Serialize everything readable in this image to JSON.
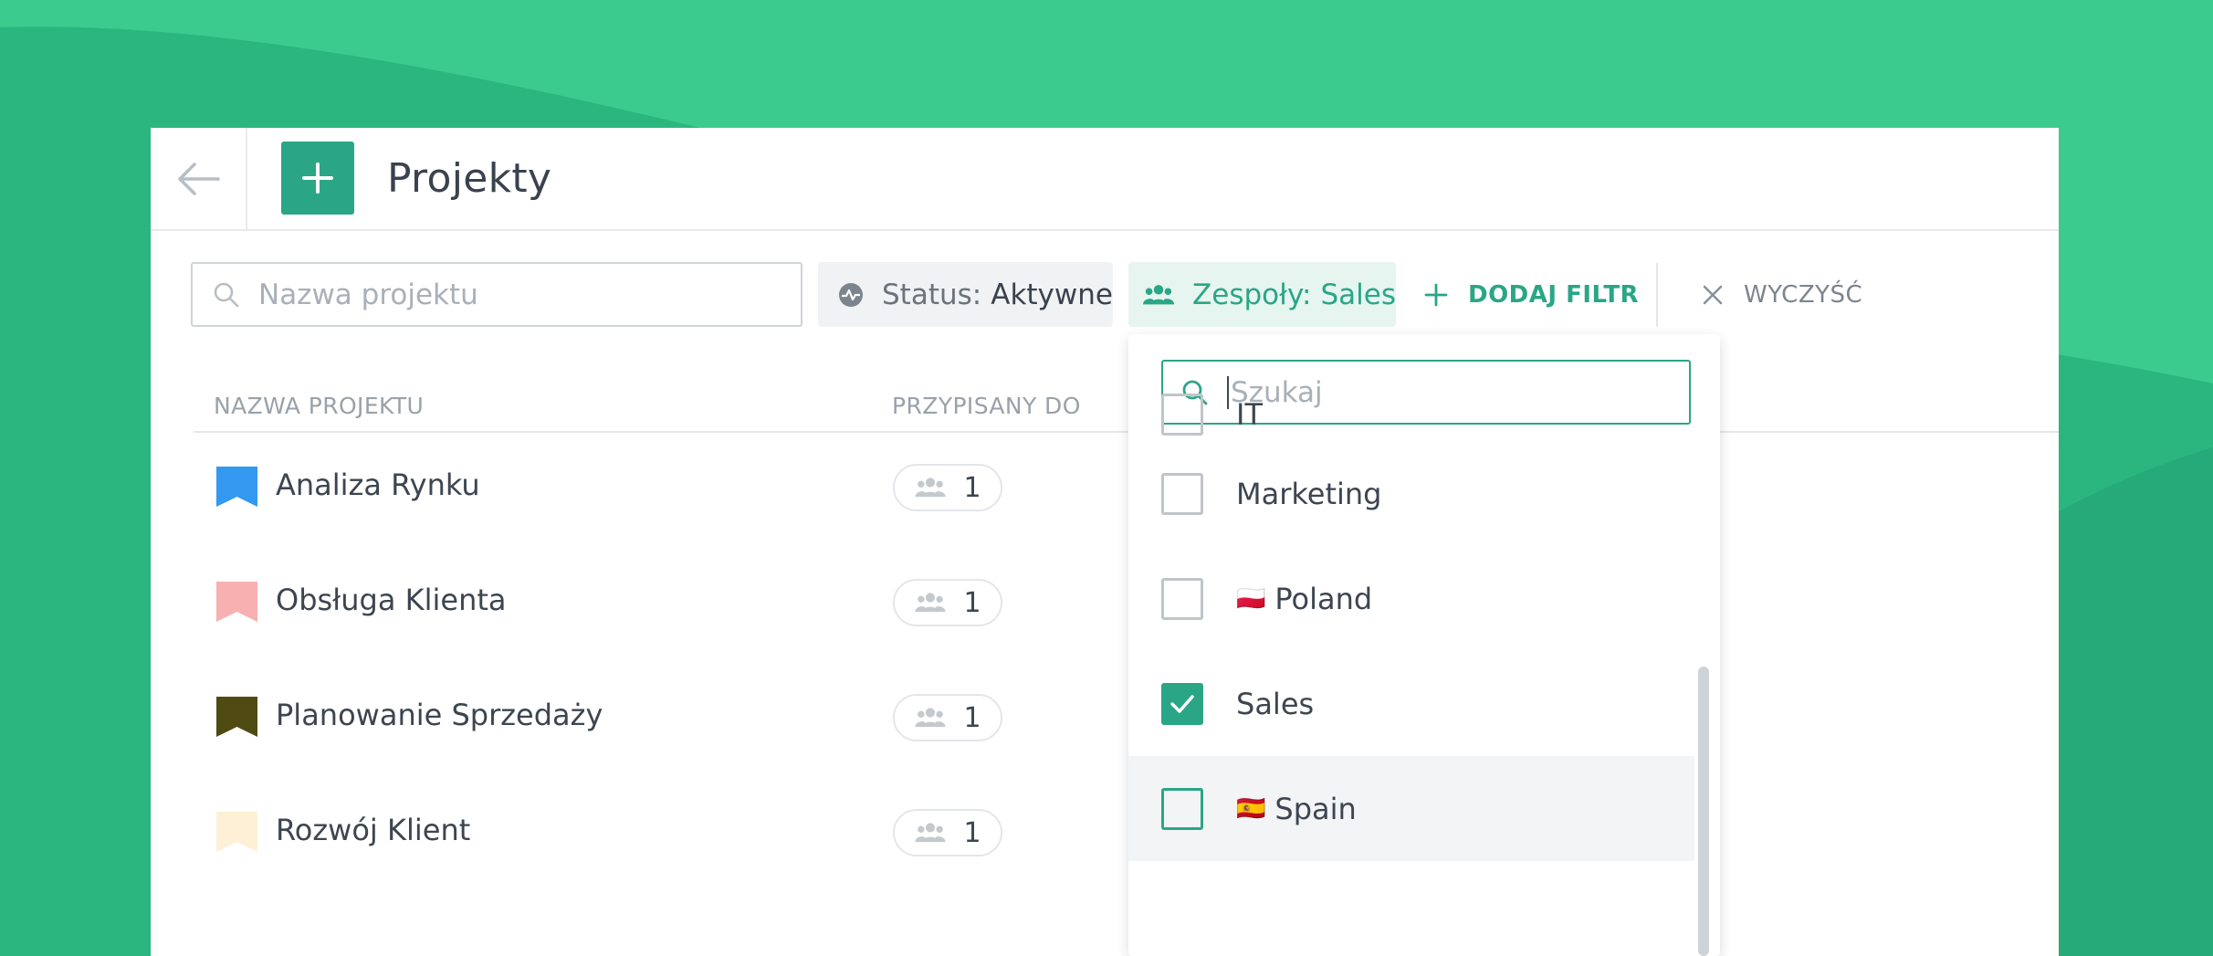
{
  "colors": {
    "background": "#29b57f",
    "accent": "#2aa686",
    "panel": "#ffffff"
  },
  "header": {
    "back_icon": "arrow-left-icon",
    "add_icon": "plus-icon",
    "title": "Projekty"
  },
  "filters": {
    "search_placeholder": "Nazwa projektu",
    "status_label": "Status:",
    "status_value": "Aktywne",
    "teams_label": "Zespoły:",
    "teams_value": "Sales",
    "add_filter": "DODAJ FILTR",
    "clear": "WYCZYŚĆ"
  },
  "table": {
    "columns": [
      "NAZWA PROJEKTU",
      "PRZYPISANY DO"
    ],
    "rows": [
      {
        "name": "Analiza Rynku",
        "flag_color": "#3398f0",
        "assigned": "1"
      },
      {
        "name": "Obsługa Klienta",
        "flag_color": "#f8b0b0",
        "assigned": "1"
      },
      {
        "name": "Planowanie Sprzedaży",
        "flag_color": "#4f4a11",
        "assigned": "1"
      },
      {
        "name": "Rozwój Klient",
        "flag_color": "#fdf0d6",
        "assigned": "1"
      }
    ]
  },
  "dropdown": {
    "search_placeholder": "Szukaj",
    "items": [
      {
        "label": "IT",
        "emoji": "",
        "checked": false
      },
      {
        "label": "Marketing",
        "emoji": "",
        "checked": false
      },
      {
        "label": "Poland",
        "emoji": "🇵🇱",
        "checked": false
      },
      {
        "label": "Sales",
        "emoji": "",
        "checked": true
      },
      {
        "label": "Spain",
        "emoji": "🇪🇸",
        "checked": false
      }
    ]
  }
}
